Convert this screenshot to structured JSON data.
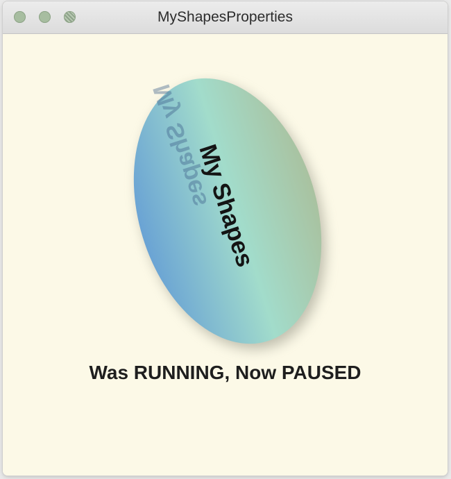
{
  "window": {
    "title": "MyShapesProperties",
    "traffic_lights": [
      "close",
      "minimize",
      "zoom"
    ]
  },
  "shape": {
    "label": "My Shapes",
    "reflection_label": "My Shapes",
    "gradient_colors": [
      "#6aa3d4",
      "#a2dccb",
      "#a9c2a0"
    ]
  },
  "status": {
    "text": "Was RUNNING, Now PAUSED"
  },
  "colors": {
    "background": "#fcf9e7",
    "titlebar": "#e3e3e3"
  }
}
